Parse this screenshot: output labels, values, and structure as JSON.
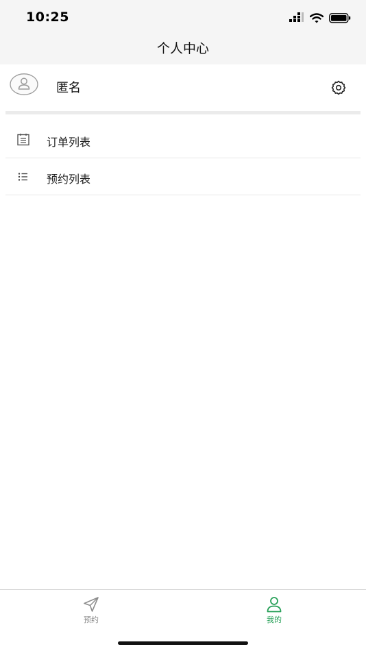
{
  "status_bar": {
    "time": "10:25"
  },
  "header": {
    "title": "个人中心"
  },
  "profile": {
    "name": "匿名"
  },
  "menu": {
    "items": [
      {
        "label": "订单列表",
        "icon": "order-list-icon"
      },
      {
        "label": "预约列表",
        "icon": "list-icon"
      }
    ]
  },
  "tabbar": {
    "tabs": [
      {
        "label": "预约",
        "icon": "navigation-arrow-icon",
        "active": false
      },
      {
        "label": "我的",
        "icon": "user-icon",
        "active": true
      }
    ]
  },
  "colors": {
    "accent": "#27a058",
    "inactive": "#8c8c8c",
    "top_background": "#f5f5f5"
  }
}
